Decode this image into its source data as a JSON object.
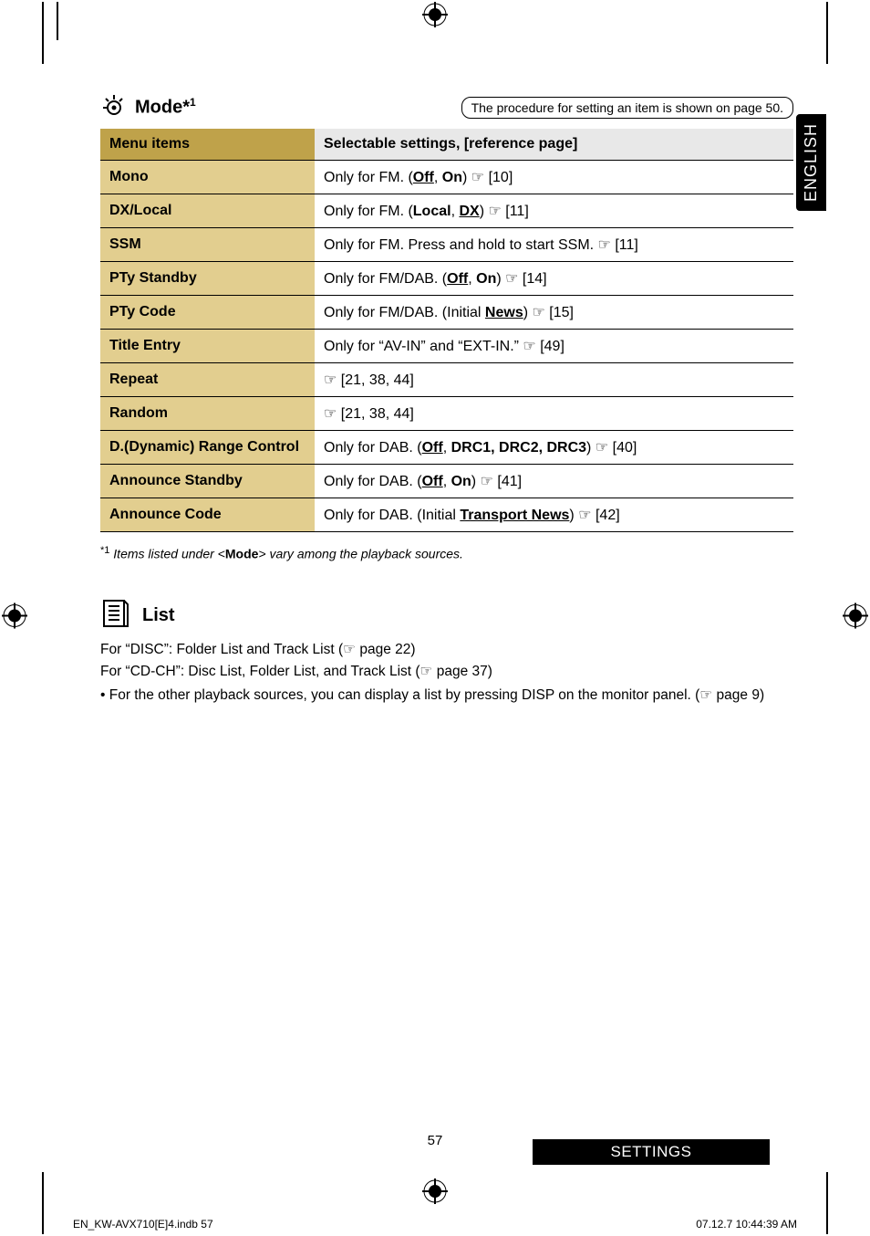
{
  "header": {
    "mode_label": "Mode*",
    "mode_sup": "1",
    "proc_note": "The procedure for setting an item is shown on page 50."
  },
  "side_tab": "ENGLISH",
  "table": {
    "headers": [
      "Menu items",
      "Selectable settings, [reference page]"
    ],
    "rows": [
      {
        "name": "Mono",
        "html": "Only for FM. (<span class='b u'>Off</span>, <span class='b'>On</span>) <span class='ptr'>☞</span> [10]"
      },
      {
        "name": "DX/Local",
        "html": "Only for FM. (<span class='b'>Local</span>, <span class='b u'>DX</span>) <span class='ptr'>☞</span> [11]"
      },
      {
        "name": "SSM",
        "html": "Only for FM. Press and hold to start SSM. <span class='ptr'>☞</span> [11]"
      },
      {
        "name": "PTy Standby",
        "html": "Only for FM/DAB. (<span class='b u'>Off</span>, <span class='b'>On</span>) <span class='ptr'>☞</span> [14]"
      },
      {
        "name": "PTy Code",
        "html": "Only for FM/DAB. (Initial <span class='b u'>News</span>) <span class='ptr'>☞</span> [15]"
      },
      {
        "name": "Title Entry",
        "html": "Only for “AV-IN” and “EXT-IN.” <span class='ptr'>☞</span> [49]"
      },
      {
        "name": "Repeat",
        "html": "<span class='ptr'>☞</span> [21, 38, 44]"
      },
      {
        "name": "Random",
        "html": "<span class='ptr'>☞</span> [21, 38, 44]"
      },
      {
        "name": "D.(Dynamic) Range Control",
        "html": "Only for DAB. (<span class='b u'>Off</span>, <span class='b'>DRC1, DRC2, DRC3</span>) <span class='ptr'>☞</span> [40]"
      },
      {
        "name": "Announce Standby",
        "html": "Only for DAB. (<span class='b u'>Off</span>, <span class='b'>On</span>) <span class='ptr'>☞</span> [41]"
      },
      {
        "name": "Announce Code",
        "html": "Only for DAB. (Initial <span class='b u'>Transport News</span>) <span class='ptr'>☞</span> [42]"
      }
    ]
  },
  "footnote": {
    "sup": "*1",
    "text": " Items listed under <Mode> vary among the playback sources."
  },
  "list": {
    "title": "List",
    "lines": [
      "For “DISC”: Folder List and Track List (☞ page 22)",
      "For “CD-CH”: Disc List, Folder List, and Track List (☞ page 37)",
      "• For the other playback sources, you can display a list by pressing DISP on the monitor panel. (☞ page 9)"
    ]
  },
  "settings_bar": "SETTINGS",
  "page_num": "57",
  "footer": {
    "left": "EN_KW-AVX710[E]4.indb   57",
    "right": "07.12.7   10:44:39 AM"
  }
}
